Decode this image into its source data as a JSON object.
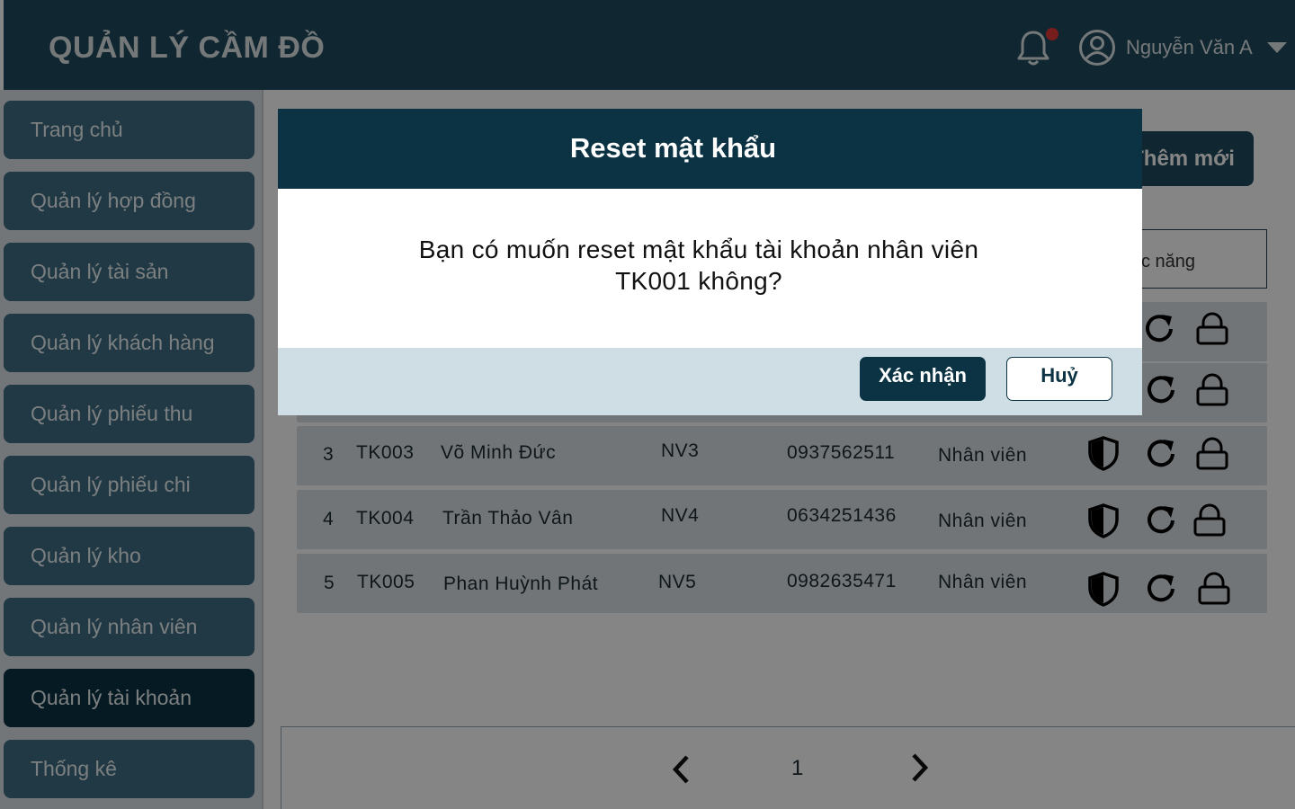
{
  "header": {
    "app_title": "QUẢN LÝ CẦM ĐỒ",
    "user_name": "Nguyễn Văn A",
    "icons": [
      "bell-icon",
      "user-circle-icon",
      "caret-down-icon"
    ],
    "notification_dot_color": "#e53935"
  },
  "sidebar": {
    "items": [
      {
        "label": "Trang chủ"
      },
      {
        "label": "Quản lý hợp đồng"
      },
      {
        "label": "Quản lý tài sản"
      },
      {
        "label": "Quản lý khách hàng"
      },
      {
        "label": "Quản lý phiếu thu"
      },
      {
        "label": "Quản lý phiếu chi"
      },
      {
        "label": "Quản lý kho"
      },
      {
        "label": "Quản lý nhân viên"
      },
      {
        "label": "Quản lý tài khoản",
        "active": true
      },
      {
        "label": "Thống kê"
      }
    ]
  },
  "main": {
    "add_button_label": "Thêm mới",
    "table": {
      "function_header": "Chức năng",
      "rows": [
        {
          "stt": "3",
          "id": "TK003",
          "name": "Võ Minh Đức",
          "staff_code": "NV3",
          "phone": "0937562511",
          "role": "Nhân viên"
        },
        {
          "stt": "4",
          "id": "TK004",
          "name": "Trần Thảo Vân",
          "staff_code": "NV4",
          "phone": "0634251436",
          "role": "Nhân viên"
        },
        {
          "stt": "5",
          "id": "TK005",
          "name": "Phan Huỳnh Phát",
          "staff_code": "NV5",
          "phone": "0982635471",
          "role": "Nhân viên"
        }
      ],
      "row_action_icons": [
        "shield-icon",
        "reset-icon",
        "lock-icon"
      ]
    },
    "pagination": {
      "current_page": "1"
    }
  },
  "modal": {
    "title": "Reset mật khẩu",
    "message": "Bạn có muốn reset mật khẩu tài khoản nhân viên TK001 không?",
    "confirm_label": "Xác nhận",
    "cancel_label": "Huỷ"
  },
  "colors": {
    "header_bg": "#1f4a5e",
    "modal_head_bg": "#0c3344",
    "nav_item_bg": "#3e6e84",
    "nav_item_active_bg": "#0c3344",
    "modal_footer_bg": "#cfdde4"
  }
}
